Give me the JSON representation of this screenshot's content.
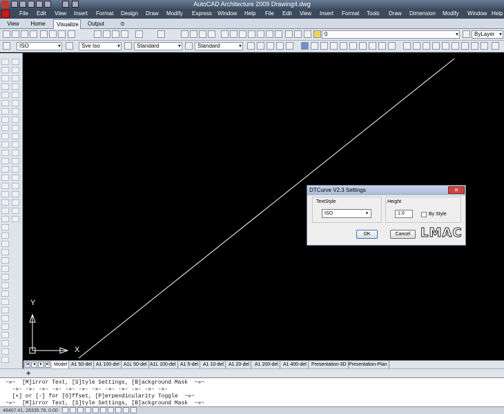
{
  "window": {
    "title": "AutoCAD Architecture 2009  Drawing4.dwg"
  },
  "menu": [
    "File",
    "Edit",
    "View",
    "Insert",
    "Format",
    "Design",
    "Draw",
    "Modify",
    "Express",
    "Window",
    "Help",
    "File",
    "Edit",
    "View",
    "Insert",
    "Format",
    "Tools",
    "Draw",
    "Dimension",
    "Modify",
    "Window",
    "Help"
  ],
  "ribbon_tabs": [
    "View",
    "Home",
    "Visualize",
    "Output"
  ],
  "ribbon_active": "Visualize",
  "toolbar": {
    "layer_value": "0",
    "linetype_value": "ByLayer",
    "textstyle": "ISO",
    "dimstyle": "Sve Iso",
    "tablestyle": "Standard",
    "mleaderstyle": "Standard"
  },
  "canvas": {
    "background": "#000000",
    "line_color": "#ffffff",
    "ucs_x_label": "X",
    "ucs_y_label": "Y"
  },
  "layout_tabs": [
    "Model",
    "A1 50-del",
    "A1 100-del",
    "A1L 50-del",
    "A1L 100-del",
    "A1 5-del",
    "A1 10-del",
    "A1 20-del",
    "A1 200-del",
    "A1 400-del",
    "Presentation-3D",
    "Presentation-Plan"
  ],
  "layout_active": "Model",
  "command_lines": [
    "~»~  [M]irror Text, [S]tyle Settings, [B]ackground Mask  ~»~",
    "  -»- -»- -»- -»- -»- -»- -»- -»- -»- -»- -»- -»-",
    "  [+] or [-] for [O]ffset, [P]erpendicularity Toggle  ~»~",
    "~»~  [M]irror Text, [S]tyle Settings, [B]ackground Mask  ~»~"
  ],
  "status": {
    "coords": "48407.41, 26335.79, 0.00"
  },
  "dialog": {
    "title": "DTCurve V2.3 Settings",
    "textstyle_label": "TextStyle",
    "textstyle_value": "ISO",
    "height_label": "Height",
    "height_value": "1.0",
    "bystyle_label": "By Style",
    "ok_label": "OK",
    "cancel_label": "Cancel",
    "brand": "LMAC"
  }
}
